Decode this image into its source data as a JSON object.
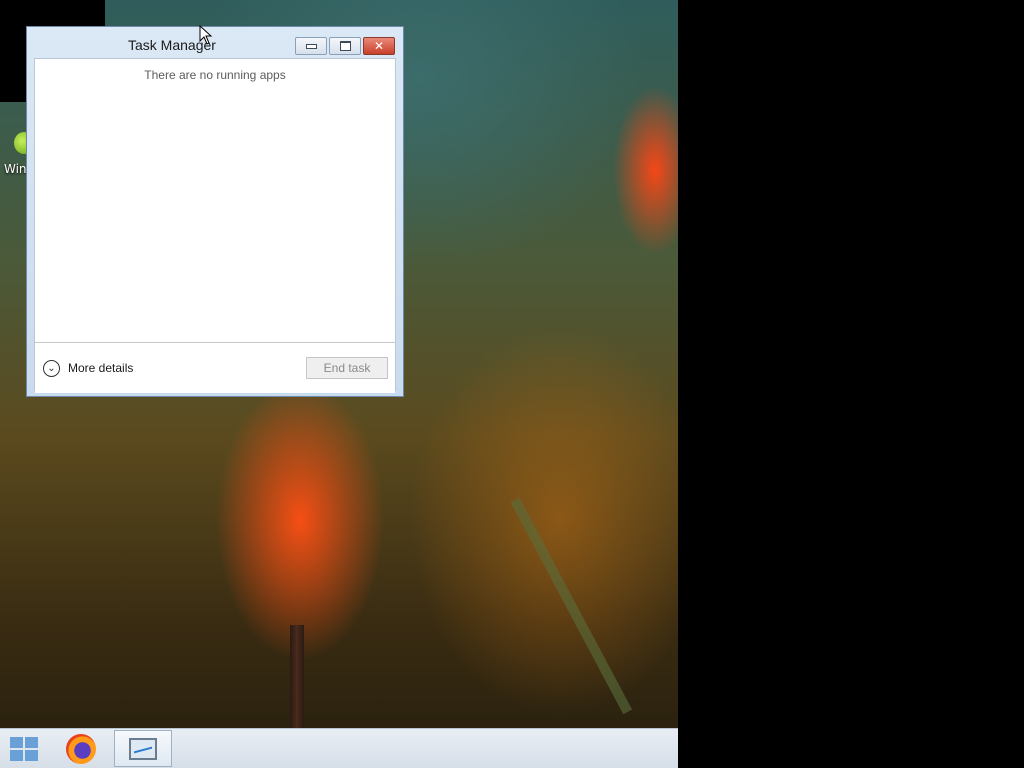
{
  "window": {
    "title": "Task Manager",
    "empty_message": "There are no running apps",
    "more_details_label": "More details",
    "end_task_label": "End task"
  },
  "desktop": {
    "icon_label": "Win"
  },
  "taskbar": {
    "items": [
      {
        "name": "start-button",
        "icon": "windows-logo-icon"
      },
      {
        "name": "firefox",
        "icon": "firefox-icon"
      },
      {
        "name": "task-manager",
        "icon": "task-manager-icon",
        "active": true
      }
    ]
  },
  "colors": {
    "close_button": "#c8402a",
    "window_frame": "#c9dbee",
    "start_logo": "#6aa0d8"
  }
}
